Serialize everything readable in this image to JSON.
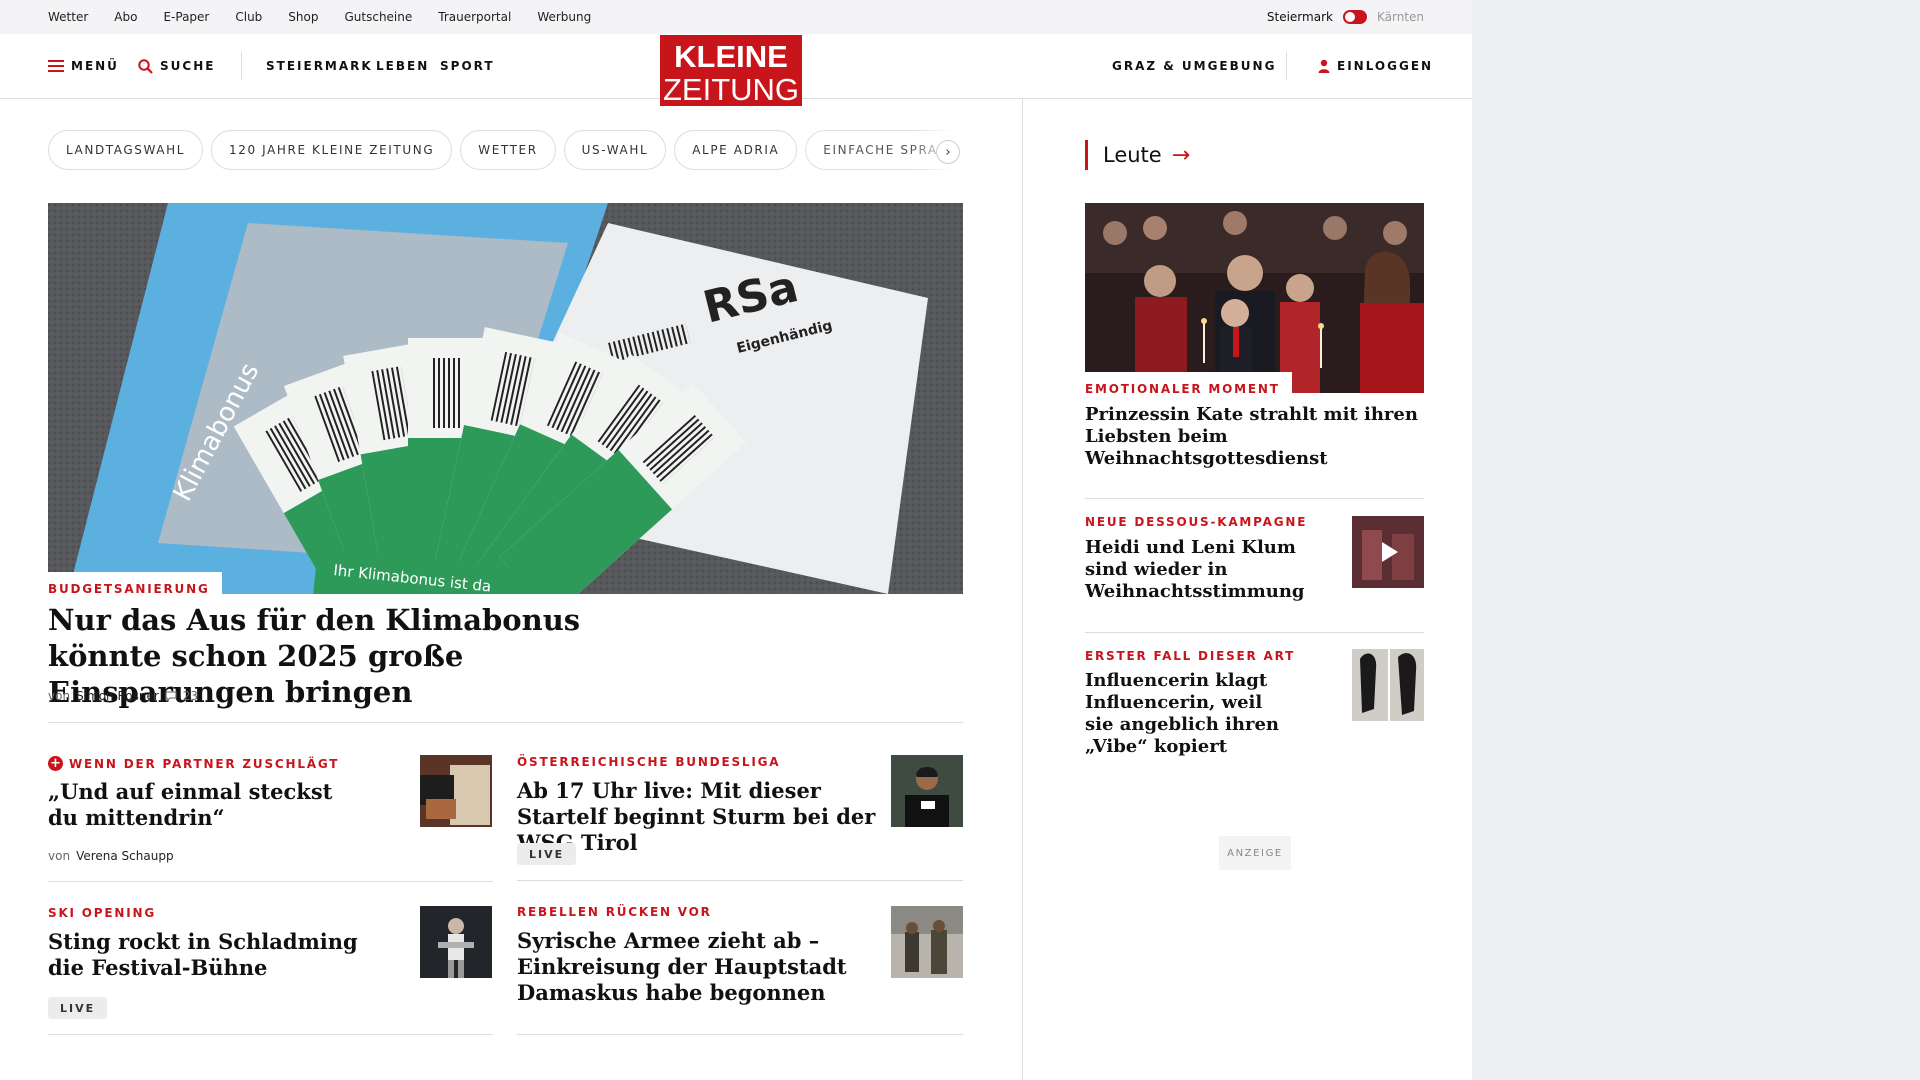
{
  "util_bar": {
    "links": [
      "Wetter",
      "Abo",
      "E-Paper",
      "Club",
      "Shop",
      "Gutscheine",
      "Trauerportal",
      "Werbung"
    ],
    "region_active": "Steiermark",
    "region_inactive": "Kärnten"
  },
  "header": {
    "menu_label": "MENÜ",
    "search_label": "SUCHE",
    "nav": [
      "STEIERMARK",
      "LEBEN",
      "SPORT"
    ],
    "logo_line1": "KLEINE",
    "logo_line2": "ZEITUNG",
    "region_link": "GRAZ & UMGEBUNG",
    "login_label": "EINLOGGEN"
  },
  "chips": [
    "LANDTAGSWAHL",
    "120 JAHRE KLEINE ZEITUNG",
    "WETTER",
    "US-WAHL",
    "ALPE ADRIA",
    "EINFACHE SPRACHE"
  ],
  "hero": {
    "kicker": "BUDGETSANIERUNG",
    "title": "Nur das Aus für den Klimabonus könnte schon 2025 große Einsparungen bringen",
    "by_prefix": "von",
    "author": "Simon Rosner",
    "comments": "23",
    "image_text_1": "RSa",
    "image_text_2": "Eigenhändig",
    "image_text_3": "Klimabonus",
    "image_text_4": "Ihr Klimabonus ist da"
  },
  "articles": [
    {
      "kicker": "WENN DER PARTNER ZUSCHLÄGT",
      "title": "„Und auf einmal steckst du mittendrin“",
      "by_prefix": "von",
      "author": "Verena Schaupp"
    },
    {
      "kicker": "ÖSTERREICHISCHE BUNDESLIGA",
      "title": "Ab 17 Uhr live: Mit dieser Startelf beginnt Sturm bei der WSG Tirol",
      "live": "LIVE"
    },
    {
      "kicker": "SKI OPENING",
      "title": "Sting rockt in Schladming die Festival-Bühne",
      "live": "LIVE"
    },
    {
      "kicker": "REBELLEN RÜCKEN VOR",
      "title": "Syrische Armee zieht ab – Einkreisung der Hauptstadt Damaskus habe begonnen"
    }
  ],
  "sidebar": {
    "heading": "Leute",
    "items": [
      {
        "kicker": "EMOTIONALER MOMENT",
        "title": "Prinzessin Kate strahlt mit ihren Liebsten beim Weihnachtsgottesdienst"
      },
      {
        "kicker": "NEUE DESSOUS-KAMPAGNE",
        "title": "Heidi und Leni Klum sind wieder in Weihnachtsstimmung"
      },
      {
        "kicker": "ERSTER FALL DIESER ART",
        "title": "Influencerin klagt Influencerin, weil sie angeblich ihren „Vibe“ kopiert"
      }
    ],
    "ad_label": "ANZEIGE"
  },
  "colors": {
    "brand": "#c8151b",
    "text": "#111111",
    "divider": "#dddddd"
  }
}
